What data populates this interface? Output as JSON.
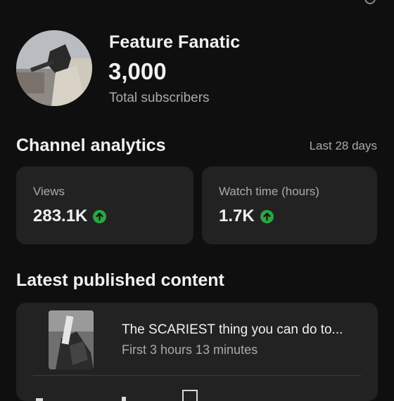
{
  "channel": {
    "name": "Feature Fanatic",
    "subscribers": "3,000",
    "subscribers_label": "Total subscribers"
  },
  "analytics": {
    "title": "Channel analytics",
    "period": "Last 28 days",
    "cards": [
      {
        "label": "Views",
        "value": "283.1K",
        "trend_icon": "arrow-up-circle-icon"
      },
      {
        "label": "Watch time (hours)",
        "value": "1.7K",
        "trend_icon": "arrow-up-circle-icon"
      }
    ]
  },
  "latest": {
    "title": "Latest published content",
    "video": {
      "title": "The SCARIEST thing you can do to...",
      "meta": "First 3 hours 13 minutes"
    }
  },
  "colors": {
    "background": "#0f0f0f",
    "card": "#222222",
    "trend_up": "#2ba640",
    "secondary_text": "#aaaaaa"
  }
}
